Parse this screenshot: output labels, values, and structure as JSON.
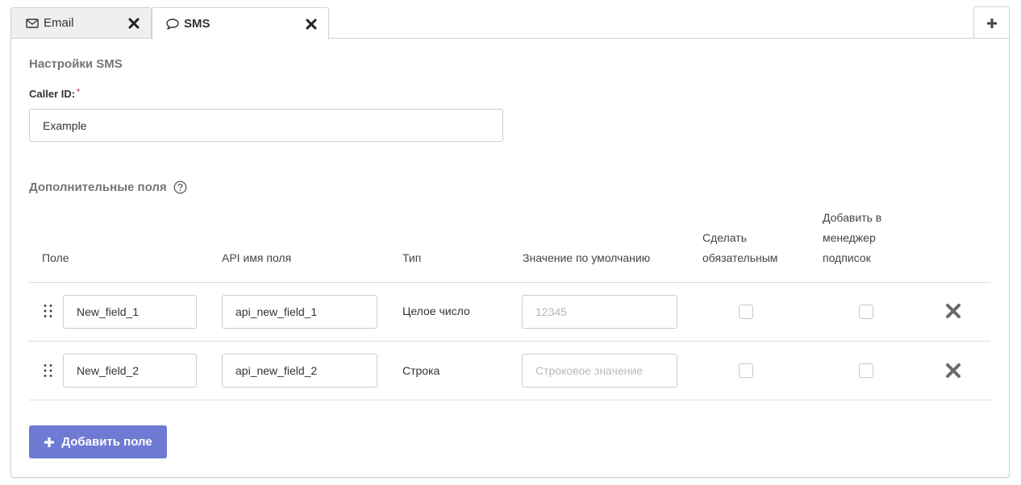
{
  "tabs": [
    {
      "label": "Email",
      "icon": "envelope-icon",
      "active": false
    },
    {
      "label": "SMS",
      "icon": "speech-bubble-icon",
      "active": true
    }
  ],
  "settings": {
    "title": "Настройки SMS",
    "caller_id_label": "Caller ID:",
    "required_mark": "*",
    "caller_id_value": "Example"
  },
  "extra_fields": {
    "title": "Дополнительные поля",
    "columns": {
      "field": "Поле",
      "api_name": "API имя поля",
      "type": "Тип",
      "default": "Значение по умолчанию",
      "required_1": "Сделать",
      "required_2": "обязательным",
      "subscription_1": "Добавить в",
      "subscription_2": "менеджер",
      "subscription_3": "подписок"
    },
    "rows": [
      {
        "field": "New_field_1",
        "api_name": "api_new_field_1",
        "type": "Целое число",
        "default_placeholder": "12345",
        "required": false,
        "subscription": false
      },
      {
        "field": "New_field_2",
        "api_name": "api_new_field_2",
        "type": "Строка",
        "default_placeholder": "Строковое значение",
        "required": false,
        "subscription": false
      }
    ],
    "add_button": "Добавить поле"
  },
  "colors": {
    "accent": "#6f7bd2",
    "required": "#d9534f"
  }
}
